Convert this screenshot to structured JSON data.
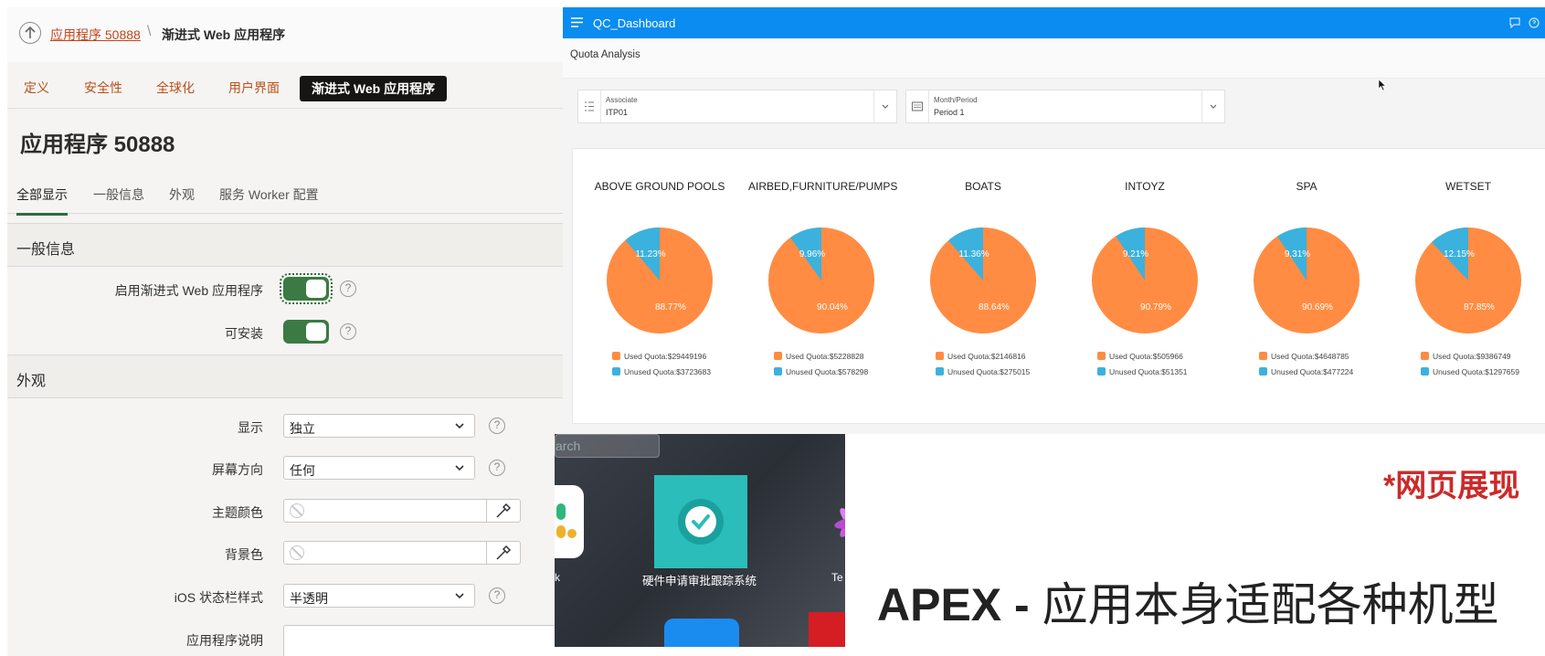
{
  "left": {
    "breadcrumb": {
      "link": "应用程序 50888",
      "separator": "\\",
      "current": "渐进式 Web 应用程序"
    },
    "tabs": [
      "定义",
      "安全性",
      "全球化",
      "用户界面",
      "渐进式 Web 应用程序"
    ],
    "page_title": "应用程序 50888",
    "subtabs": [
      "全部显示",
      "一般信息",
      "外观",
      "服务 Worker 配置"
    ],
    "section_general": "一般信息",
    "enable_pwa_label": "启用渐进式 Web 应用程序",
    "installable_label": "可安装",
    "section_appearance": "外观",
    "display_label": "显示",
    "display_value": "独立",
    "orientation_label": "屏幕方向",
    "orientation_value": "任何",
    "theme_color_label": "主题颜色",
    "bg_color_label": "背景色",
    "ios_status_label": "iOS 状态栏样式",
    "ios_status_value": "半透明",
    "app_desc_label": "应用程序说明",
    "help_glyph": "?"
  },
  "dashboard": {
    "title": "QC_Dashboard",
    "section": "Quota Analysis",
    "filters": [
      {
        "label": "Associate",
        "value": "ITP01"
      },
      {
        "label": "Month/Period",
        "value": "Period 1"
      }
    ],
    "colors": {
      "used": "#ff8c42",
      "unused": "#3bb1de",
      "header": "#0a8cf0"
    },
    "pies": [
      {
        "title": "ABOVE GROUND POOLS",
        "used_pct": "88.77%",
        "unused_pct": "11.23%",
        "used": "Used Quota:$29449196",
        "unused": "Unused Quota:$3723683",
        "unused_frac": 0.1123
      },
      {
        "title": "AIRBED,FURNITURE/PUMPS",
        "used_pct": "90.04%",
        "unused_pct": "9.96%",
        "used": "Used Quota:$5228828",
        "unused": "Unused Quota:$578298",
        "unused_frac": 0.0996
      },
      {
        "title": "BOATS",
        "used_pct": "88.64%",
        "unused_pct": "11.36%",
        "used": "Used Quota:$2146816",
        "unused": "Unused Quota:$275015",
        "unused_frac": 0.1136
      },
      {
        "title": "INTOYZ",
        "used_pct": "90.79%",
        "unused_pct": "9.21%",
        "used": "Used Quota:$505966",
        "unused": "Unused Quota:$51351",
        "unused_frac": 0.0921
      },
      {
        "title": "SPA",
        "used_pct": "90.69%",
        "unused_pct": "9.31%",
        "used": "Used Quota:$4648785",
        "unused": "Unused Quota:$477224",
        "unused_frac": 0.0931
      },
      {
        "title": "WETSET",
        "used_pct": "87.85%",
        "unused_pct": "12.15%",
        "used": "Used Quota:$9386749",
        "unused": "Unused Quota:$1297659",
        "unused_frac": 0.1215
      }
    ]
  },
  "photo": {
    "search_text": "arch",
    "app_name": "硬件申请审批跟踪系统",
    "partial_left": "k",
    "partial_right": "Te"
  },
  "note": "*网页展现",
  "headline": {
    "bold": "APEX -",
    "rest": " 应用本身适配各种机型"
  }
}
